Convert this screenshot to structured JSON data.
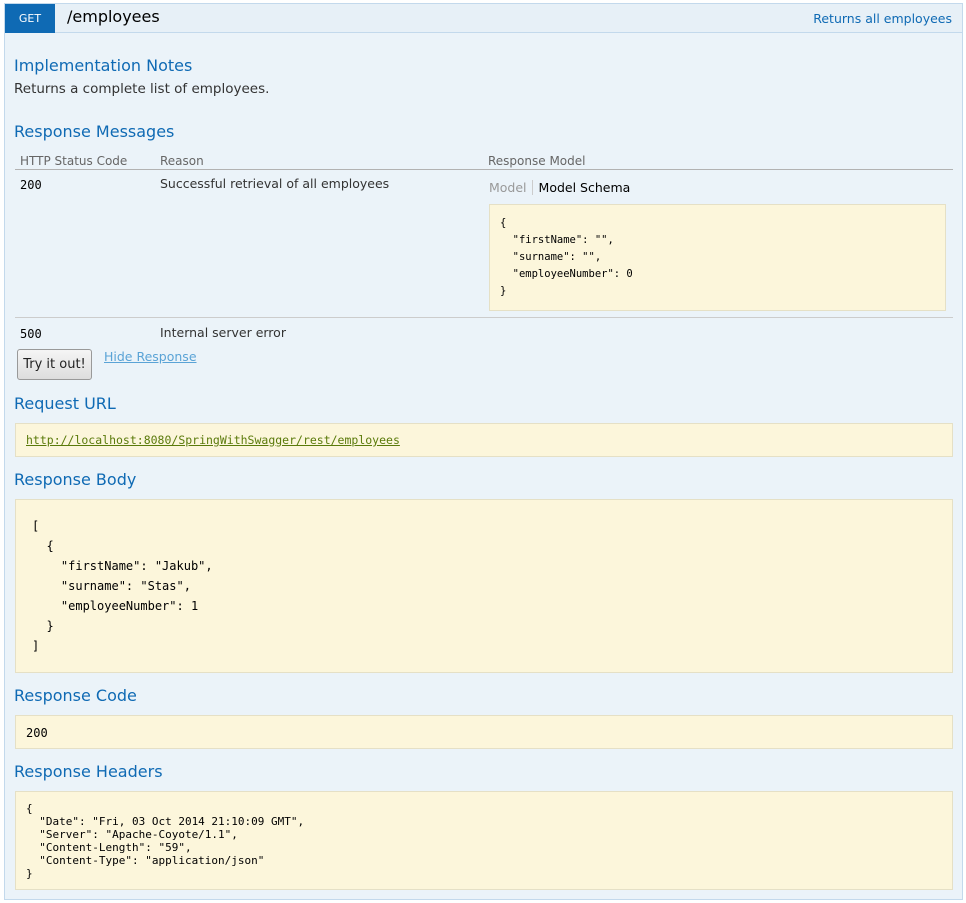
{
  "operation": {
    "method": "GET",
    "path": "/employees",
    "summary": "Returns all employees"
  },
  "implementation": {
    "heading": "Implementation Notes",
    "notes": "Returns a complete list of employees."
  },
  "response_messages": {
    "heading": "Response Messages",
    "columns": [
      "HTTP Status Code",
      "Reason",
      "Response Model"
    ],
    "rows": [
      {
        "code": "200",
        "reason": "Successful retrieval of all employees"
      },
      {
        "code": "500",
        "reason": "Internal server error"
      }
    ],
    "model_tabs": {
      "model": "Model",
      "schema": "Model Schema"
    },
    "schema_lines": [
      "{",
      "  \"firstName\": \"\",",
      "  \"surname\": \"\",",
      "  \"employeeNumber\": 0",
      "}"
    ]
  },
  "actions": {
    "try_button": "Try it out!",
    "hide_link": "Hide Response"
  },
  "request_url": {
    "heading": "Request URL",
    "url": "http://localhost:8080/SpringWithSwagger/rest/employees"
  },
  "response_body": {
    "heading": "Response Body",
    "lines": [
      "[",
      "  {",
      "    \"firstName\": \"Jakub\",",
      "    \"surname\": \"Stas\",",
      "    \"employeeNumber\": 1",
      "  }",
      "]"
    ]
  },
  "response_code": {
    "heading": "Response Code",
    "value": "200"
  },
  "response_headers": {
    "heading": "Response Headers",
    "lines": [
      "{",
      "  \"Date\": \"Fri, 03 Oct 2014 21:10:09 GMT\",",
      "  \"Server\": \"Apache-Coyote/1.1\",",
      "  \"Content-Length\": \"59\",",
      "  \"Content-Type\": \"application/json\"",
      "}"
    ]
  },
  "colors": {
    "method_badge": "#0f6ab4",
    "heading": "#0f6ab4",
    "panel_bg": "#ebf3f9",
    "snippet_bg": "#fcf6db"
  }
}
